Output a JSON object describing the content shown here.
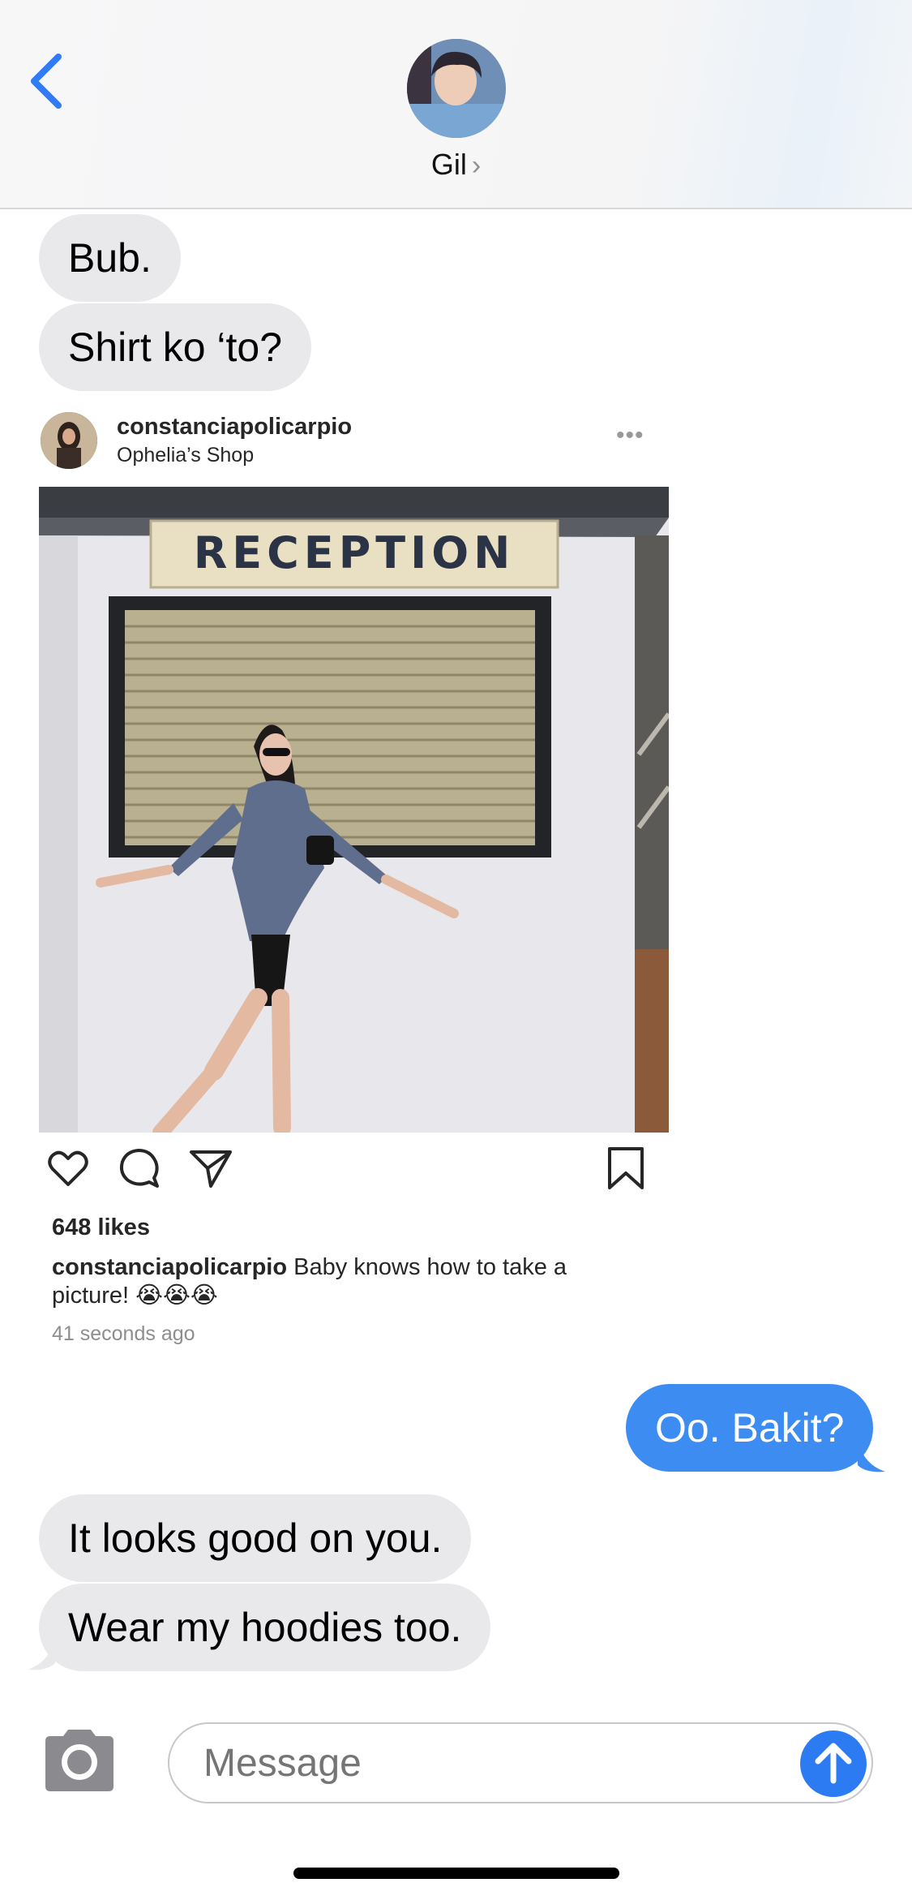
{
  "header": {
    "contact_name": "Gil",
    "chevron": "›",
    "back_icon": "chevron-left-icon"
  },
  "messages_top": [
    {
      "text": "Bub.",
      "direction": "received"
    },
    {
      "text": "Shirt ko ‘to?",
      "direction": "received"
    }
  ],
  "instagram_post": {
    "username": "constanciapolicarpio",
    "subtitle": "Ophelia’s Shop",
    "sign_text": "RECEPTION",
    "likes": "648 likes",
    "caption_user": "constanciapolicarpio",
    "caption_text": "Baby knows how to take a picture! 😭😭😭",
    "time_ago": "41 seconds ago"
  },
  "messages_bottom": [
    {
      "text": "Oo. Bakit?",
      "direction": "sent"
    },
    {
      "text": "It looks good on you.",
      "direction": "received"
    },
    {
      "text": "Wear my hoodies too.",
      "direction": "received"
    }
  ],
  "input": {
    "placeholder": "Message"
  },
  "colors": {
    "sent_bubble": "#3d8cf2",
    "received_bubble": "#e9e9eb",
    "accent": "#2d7bf2"
  }
}
